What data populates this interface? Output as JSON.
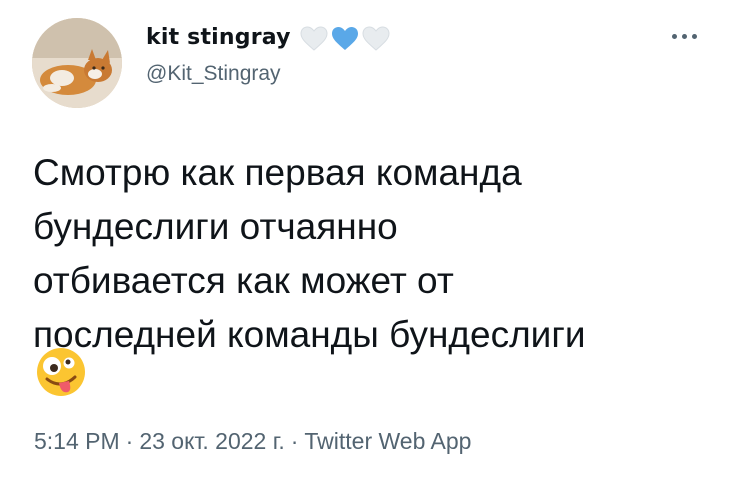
{
  "author": {
    "display_name": "kit stingray",
    "handle": "@Kit_Stingray",
    "badge_hearts": [
      "white-heart-icon",
      "blue-heart-icon",
      "white-heart-icon"
    ]
  },
  "tweet": {
    "lines": [
      "Смотрю как первая команда",
      "бундеслиги отчаянно",
      "отбивается как может от",
      "последней команды бундеслиги"
    ],
    "emoji": "zany-face-emoji"
  },
  "meta": {
    "time": "5:14 PM",
    "date": "23 окт. 2022 г.",
    "separator": "·",
    "source": "Twitter Web App"
  },
  "colors": {
    "text": "#0f1419",
    "secondary": "#536471",
    "heart_blue": "#5aa8e8",
    "heart_white": "#e8ecef"
  }
}
